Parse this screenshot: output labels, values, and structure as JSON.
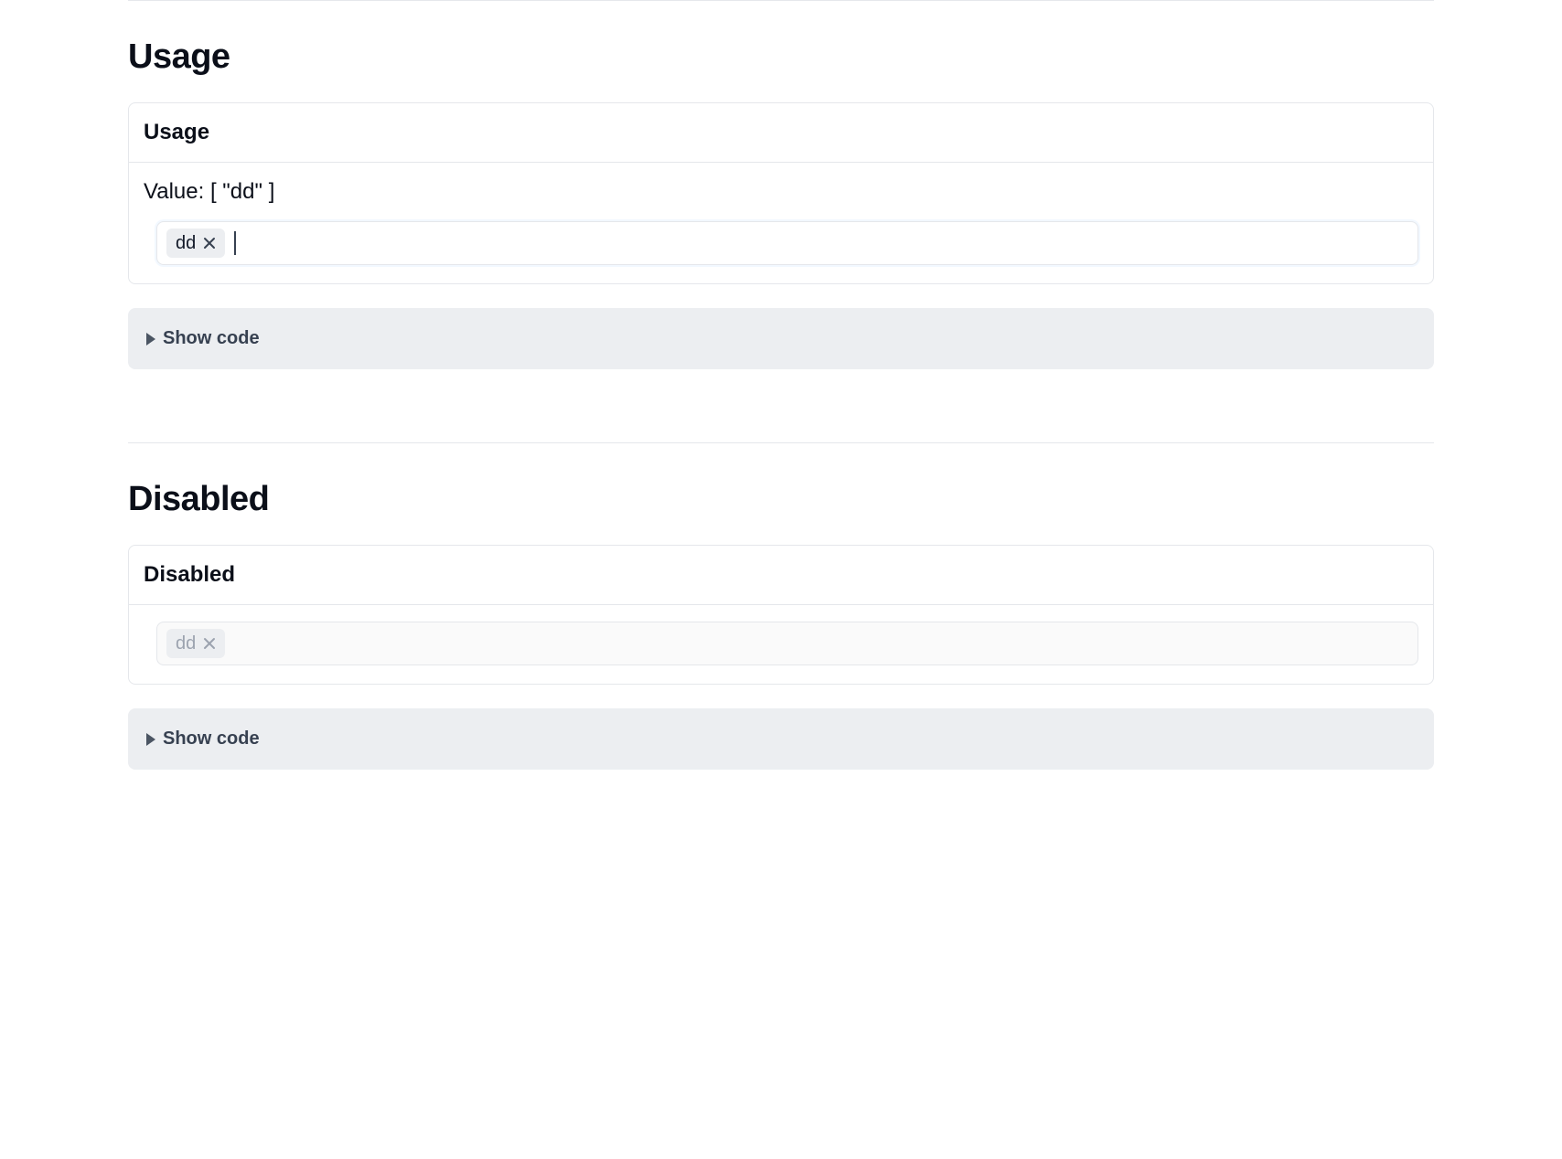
{
  "sections": {
    "usage": {
      "heading": "Usage",
      "card_title": "Usage",
      "value_prefix": "Value:",
      "value_display": "[ \"dd\" ]",
      "tags": [
        {
          "label": "dd"
        }
      ],
      "show_code_label": "Show code"
    },
    "disabled": {
      "heading": "Disabled",
      "card_title": "Disabled",
      "tags": [
        {
          "label": "dd"
        }
      ],
      "show_code_label": "Show code"
    }
  },
  "icons": {
    "close_stroke": "#374151",
    "close_stroke_disabled": "#9ca3af"
  }
}
